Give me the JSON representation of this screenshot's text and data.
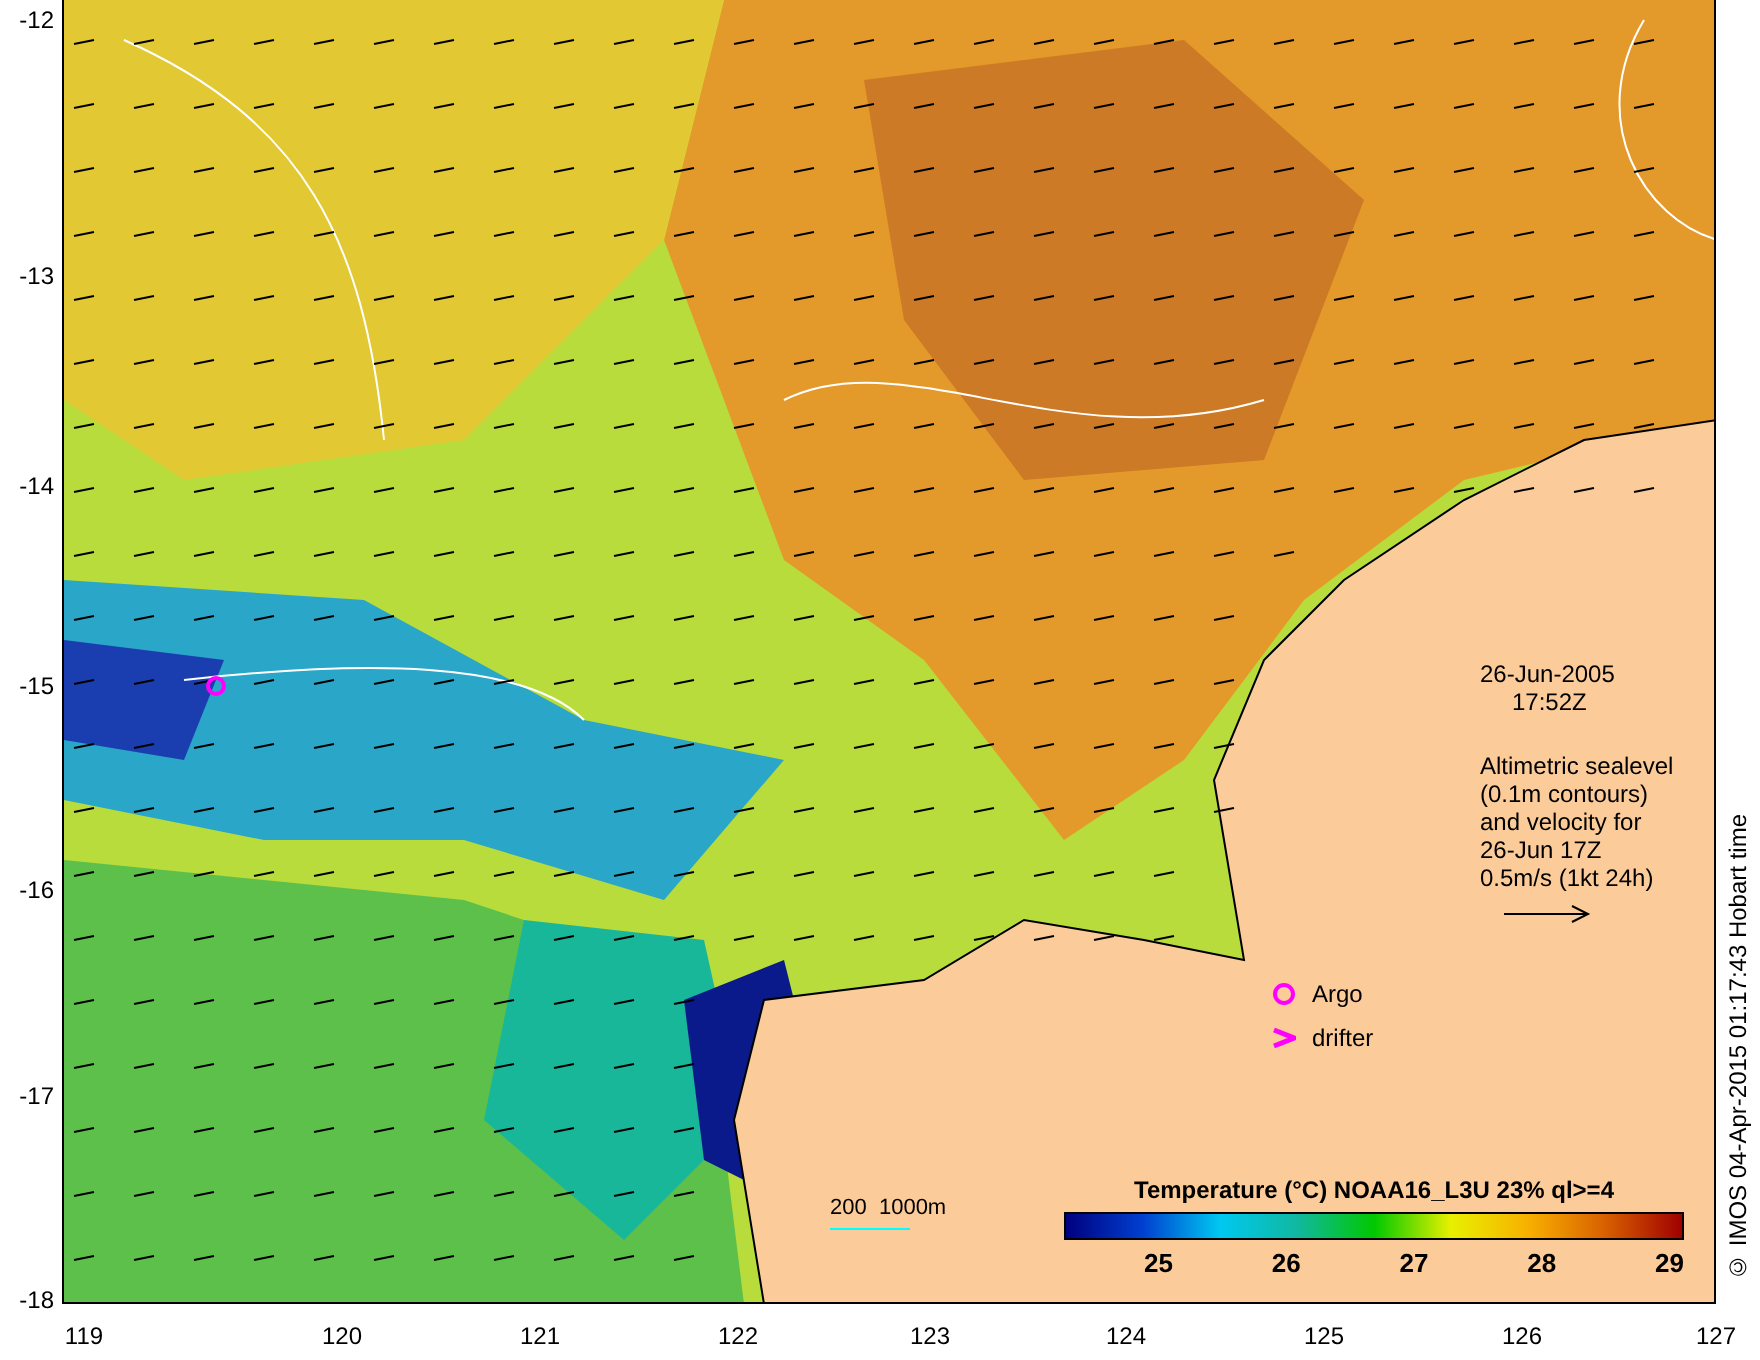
{
  "map": {
    "y_ticks": [
      "-12",
      "-13",
      "-14",
      "-15",
      "-16",
      "-17",
      "-18"
    ],
    "x_ticks": [
      "119",
      "120",
      "121",
      "122",
      "123",
      "124",
      "125",
      "126",
      "127"
    ],
    "date": "26-Jun-2005",
    "time": "17:52Z",
    "altimetry_note": [
      "Altimetric sealevel",
      "(0.1m contours)",
      "and velocity for",
      "26-Jun 17Z",
      "0.5m/s (1kt 24h)"
    ],
    "legend": [
      {
        "kind": "argo",
        "label": "Argo"
      },
      {
        "kind": "drifter",
        "label": "drifter"
      }
    ],
    "depth_scale": "200  1000m",
    "colorbar": {
      "title": "Temperature (°C) NOAA16_L3U 23% ql>=4",
      "ticks": [
        "25",
        "26",
        "27",
        "28",
        "29"
      ]
    },
    "credit": "© IMOS 04-Apr-2015 01:17:43 Hobart time"
  }
}
